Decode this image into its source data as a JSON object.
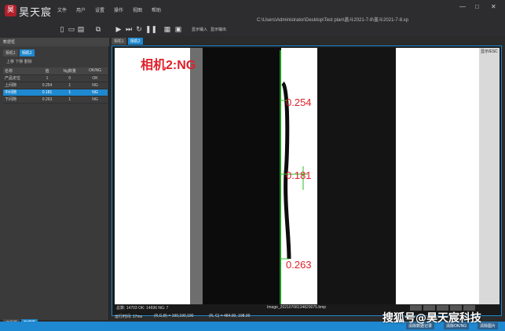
{
  "app": {
    "logo_glyph": "昊",
    "brand": "昊天宸",
    "menu": [
      "文件",
      "用户",
      "设置",
      "操作",
      "视图",
      "帮助"
    ],
    "file_path": "C:\\Users\\Administrator\\Desktop\\Test plan\\盖斗2021-7-8\\盖斗2021-7-8.xp",
    "window_controls": [
      "—",
      "□",
      "✕"
    ]
  },
  "toolbar": {
    "icons": [
      "new-file-icon",
      "open-folder-icon",
      "save-icon",
      "layout-icon",
      "play-icon",
      "step-icon",
      "loop-icon",
      "pause-icon",
      "grid-icon",
      "lock-icon"
    ],
    "text_a": "显示输入",
    "text_b": "显示输出"
  },
  "left_panel": {
    "title": "数据框",
    "tabs": [
      "相机1",
      "相机2"
    ],
    "active_tab": 1,
    "sub_actions": "上移 下移 删除",
    "columns": [
      "名称",
      "值",
      "Ng数量",
      "OK/NG"
    ],
    "rows": [
      {
        "name": "产品定位",
        "value": "1",
        "ng": "0",
        "result": "OK"
      },
      {
        "name": "上间隙",
        "value": "0.254",
        "ng": "1",
        "result": "NG"
      },
      {
        "name": "中间隙",
        "value": "0.181",
        "ng": "1",
        "result": "NG"
      },
      {
        "name": "下间隙",
        "value": "0.263",
        "ng": "1",
        "result": "NG"
      }
    ],
    "selected_row": 2,
    "bottom_tabs": [
      "流程框",
      "数据框"
    ],
    "active_bottom_tab": 1
  },
  "view": {
    "tabs": [
      "相机1",
      "相机2"
    ],
    "active_tab": 1,
    "camera_label": "相机2:NG",
    "measurements": [
      "0.254",
      "0.181",
      "0.263"
    ],
    "corner_label": "显示/ESC",
    "status_counts": "总数: 14703  OK: 14696  NG: 7",
    "image_name": "Image_20210708134829075.bmp",
    "footer_time": "运行时间: 17ms",
    "footer_rgb": "(R,G,B) = 190,190,190",
    "footer_pos": "(R, C) = 484.00, 198.00"
  },
  "bottom_bar": {
    "buttons": [
      "清除数据记录",
      "清除OK/NG",
      "清除图片"
    ]
  },
  "watermark": "搜狐号@昊天宸科技",
  "colors": {
    "accent": "#1e88d0",
    "ng_red": "#e0202a",
    "measure_green": "#22c322"
  }
}
